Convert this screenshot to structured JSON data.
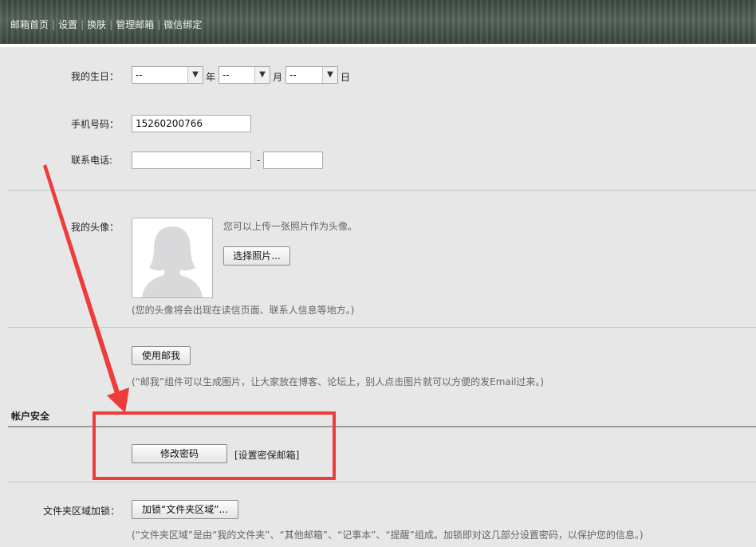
{
  "nav": {
    "items": [
      "邮箱首页",
      "设置",
      "换肤",
      "管理邮箱",
      "微信绑定"
    ],
    "separator": "|"
  },
  "birthday": {
    "label": "我的生日：",
    "year_value": "--",
    "year_unit": "年",
    "month_value": "--",
    "month_unit": "月",
    "day_value": "--",
    "day_unit": "日"
  },
  "mobile": {
    "label": "手机号码：",
    "value": "15260200766"
  },
  "phone": {
    "label": "联系电话:",
    "area_value": "",
    "dash": "-",
    "number_value": ""
  },
  "avatar": {
    "label": "我的头像：",
    "hint": "您可以上传一张照片作为头像。",
    "choose_button": "选择照片...",
    "note": "(您的头像将会出现在读信页面、联系人信息等地方。)"
  },
  "mailme": {
    "button": "使用邮我",
    "note": "(“邮我”组件可以生成图片，让大家放在博客、论坛上，别人点击图片就可以方便的发Email过来。)"
  },
  "security": {
    "title": "帐户安全",
    "change_password_button": "修改密码",
    "secure_mailbox_link": "[设置密保邮箱]"
  },
  "folder_lock": {
    "label": "文件夹区域加锁：",
    "button": "加锁“文件夹区域”...",
    "note": "(“文件夹区域”是由“我的文件夹”、“其他邮箱”、“记事本”、“提醒”组成。加锁即对这几部分设置密码，以保护您的信息。)"
  },
  "annotation": {
    "color": "#ee3b3b"
  }
}
